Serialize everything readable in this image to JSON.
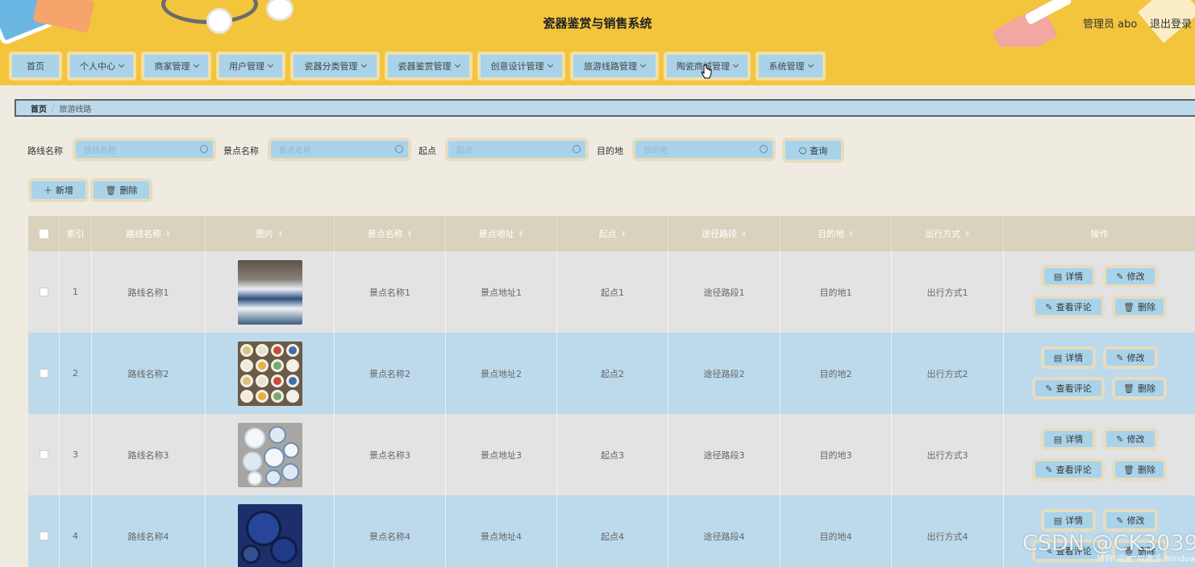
{
  "header": {
    "title": "瓷器鉴赏与销售系统",
    "admin": "管理员 abo",
    "logout": "退出登录"
  },
  "nav": {
    "items": [
      {
        "label": "首页",
        "dropdown": false
      },
      {
        "label": "个人中心",
        "dropdown": true
      },
      {
        "label": "商家管理",
        "dropdown": true
      },
      {
        "label": "用户管理",
        "dropdown": true
      },
      {
        "label": "瓷器分类管理",
        "dropdown": true
      },
      {
        "label": "瓷器鉴赏管理",
        "dropdown": true
      },
      {
        "label": "创意设计管理",
        "dropdown": true
      },
      {
        "label": "旅游线路管理",
        "dropdown": true
      },
      {
        "label": "陶瓷商城管理",
        "dropdown": true
      },
      {
        "label": "系统管理",
        "dropdown": true
      }
    ]
  },
  "breadcrumb": {
    "home": "首页",
    "separator": "/",
    "current": "旅游线路"
  },
  "search": {
    "route_label": "路线名称",
    "route_placeholder": "路线名称",
    "spot_label": "景点名称",
    "spot_placeholder": "景点名称",
    "start_label": "起点",
    "start_placeholder": "起点",
    "dest_label": "目的地",
    "dest_placeholder": "目的地",
    "query_button": "查询"
  },
  "actions": {
    "add": "新增",
    "delete": "删除"
  },
  "table": {
    "headers": {
      "index": "索引",
      "route": "路线名称",
      "image": "图片",
      "spot": "景点名称",
      "address": "景点地址",
      "start": "起点",
      "path": "途径路段",
      "dest": "目的地",
      "mode": "出行方式",
      "ops": "操作"
    },
    "row_buttons": {
      "detail": "详情",
      "edit": "修改",
      "comments": "查看评论",
      "delete": "删除"
    },
    "rows": [
      {
        "index": "1",
        "route": "路线名称1",
        "spot": "景点名称1",
        "address": "景点地址1",
        "start": "起点1",
        "path": "途径路段1",
        "dest": "目的地1",
        "mode": "出行方式1"
      },
      {
        "index": "2",
        "route": "路线名称2",
        "spot": "景点名称2",
        "address": "景点地址2",
        "start": "起点2",
        "path": "途径路段2",
        "dest": "目的地2",
        "mode": "出行方式2"
      },
      {
        "index": "3",
        "route": "路线名称3",
        "spot": "景点名称3",
        "address": "景点地址3",
        "start": "起点3",
        "path": "途径路段3",
        "dest": "目的地3",
        "mode": "出行方式3"
      },
      {
        "index": "4",
        "route": "路线名称4",
        "spot": "景点名称4",
        "address": "景点地址4",
        "start": "起点4",
        "path": "途径路段4",
        "dest": "目的地4",
        "mode": "出行方式4"
      }
    ]
  },
  "watermark": {
    "text": "CSDN @CK3039",
    "windows": "转到“设置”以激活 Windows。"
  },
  "colors": {
    "header_bg": "#f2c53d",
    "button_bg": "#a9d3ea",
    "button_border": "#e6dcc1",
    "row_blue": "#bcdaec",
    "row_grey": "#e3e3e3",
    "table_header": "#d9d2bc"
  }
}
